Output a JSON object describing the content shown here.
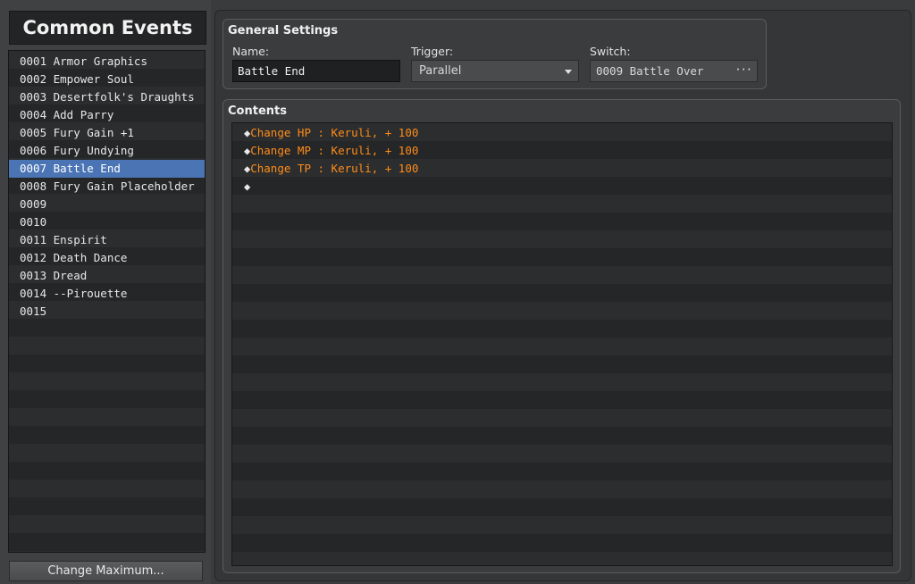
{
  "left": {
    "header": "Common Events",
    "events": [
      {
        "label": "0001 Armor Graphics"
      },
      {
        "label": "0002 Empower Soul"
      },
      {
        "label": "0003 Desertfolk's Draughts"
      },
      {
        "label": "0004 Add Parry"
      },
      {
        "label": "0005 Fury Gain +1"
      },
      {
        "label": "0006 Fury Undying"
      },
      {
        "label": "0007 Battle End",
        "selected": true
      },
      {
        "label": "0008 Fury Gain Placeholder"
      },
      {
        "label": "0009"
      },
      {
        "label": "0010"
      },
      {
        "label": "0011 Enspirit"
      },
      {
        "label": "0012 Death Dance"
      },
      {
        "label": "0013 Dread"
      },
      {
        "label": "0014 --Pirouette"
      },
      {
        "label": "0015"
      }
    ],
    "change_max_label": "Change Maximum..."
  },
  "general": {
    "title": "General Settings",
    "name_label": "Name:",
    "name_value": "Battle End",
    "trigger_label": "Trigger:",
    "trigger_value": "Parallel",
    "switch_label": "Switch:",
    "switch_value": "0009 Battle Over",
    "switch_button_icon": "ellipsis-icon"
  },
  "contents": {
    "title": "Contents",
    "commands": [
      {
        "marker": "◆",
        "text": "Change HP : Keruli, + 100"
      },
      {
        "marker": "◆",
        "text": "Change MP : Keruli, + 100"
      },
      {
        "marker": "◆",
        "text": "Change TP : Keruli, + 100"
      },
      {
        "marker": "◆",
        "text": ""
      }
    ]
  },
  "colors": {
    "selection": "#4a74b3",
    "command_text": "#ff8c1a",
    "background": "#3a3b3c"
  }
}
